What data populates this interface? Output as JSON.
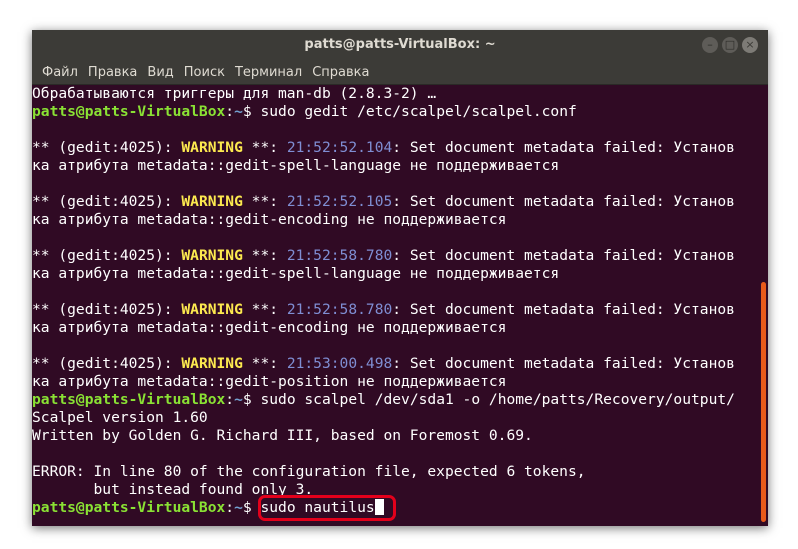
{
  "window": {
    "title": "patts@patts-VirtualBox: ~"
  },
  "controls": {
    "minimize": "–",
    "maximize": "□",
    "close": "×"
  },
  "menu": [
    "Файл",
    "Правка",
    "Вид",
    "Поиск",
    "Терминал",
    "Справка"
  ],
  "prompt": {
    "user": "patts@patts-VirtualBox",
    "sep": ":",
    "path": "~",
    "sym": "$ "
  },
  "lines": [
    {
      "kind": "text",
      "text": "Обрабатываются триггеры для man-db (2.8.3-2) …"
    },
    {
      "kind": "prompt",
      "cmd": "sudo gedit /etc/scalpel/scalpel.conf"
    },
    {
      "kind": "blank"
    },
    {
      "kind": "warn",
      "pre": "** (gedit:4025): ",
      "level": "WARNING",
      "mid": " **: ",
      "time": "21:52:52.104",
      "msg": ": Set document metadata failed: Установ"
    },
    {
      "kind": "text",
      "text": "ка атрибута metadata::gedit-spell-language не поддерживается"
    },
    {
      "kind": "blank"
    },
    {
      "kind": "warn",
      "pre": "** (gedit:4025): ",
      "level": "WARNING",
      "mid": " **: ",
      "time": "21:52:52.105",
      "msg": ": Set document metadata failed: Установ"
    },
    {
      "kind": "text",
      "text": "ка атрибута metadata::gedit-encoding не поддерживается"
    },
    {
      "kind": "blank"
    },
    {
      "kind": "warn",
      "pre": "** (gedit:4025): ",
      "level": "WARNING",
      "mid": " **: ",
      "time": "21:52:58.780",
      "msg": ": Set document metadata failed: Установ"
    },
    {
      "kind": "text",
      "text": "ка атрибута metadata::gedit-spell-language не поддерживается"
    },
    {
      "kind": "blank"
    },
    {
      "kind": "warn",
      "pre": "** (gedit:4025): ",
      "level": "WARNING",
      "mid": " **: ",
      "time": "21:52:58.780",
      "msg": ": Set document metadata failed: Установ"
    },
    {
      "kind": "text",
      "text": "ка атрибута metadata::gedit-encoding не поддерживается"
    },
    {
      "kind": "blank"
    },
    {
      "kind": "warn",
      "pre": "** (gedit:4025): ",
      "level": "WARNING",
      "mid": " **: ",
      "time": "21:53:00.498",
      "msg": ": Set document metadata failed: Установ"
    },
    {
      "kind": "text",
      "text": "ка атрибута metadata::gedit-position не поддерживается"
    },
    {
      "kind": "prompt",
      "cmd": "sudo scalpel /dev/sda1 -o /home/patts/Recovery/output/"
    },
    {
      "kind": "text",
      "text": "Scalpel version 1.60"
    },
    {
      "kind": "text",
      "text": "Written by Golden G. Richard III, based on Foremost 0.69."
    },
    {
      "kind": "blank"
    },
    {
      "kind": "text",
      "text": "ERROR: In line 80 of the configuration file, expected 6 tokens,"
    },
    {
      "kind": "text",
      "text": "       but instead found only 3."
    },
    {
      "kind": "prompt",
      "cmd": "sudo nautilus",
      "cursor": true
    }
  ],
  "colors": {
    "terminal_bg": "#300a24",
    "prompt_user": "#8ae234",
    "prompt_path": "#729fcf",
    "warning": "#fce94f",
    "timestamp": "#7f8ed3",
    "highlight": "#e3001b"
  }
}
